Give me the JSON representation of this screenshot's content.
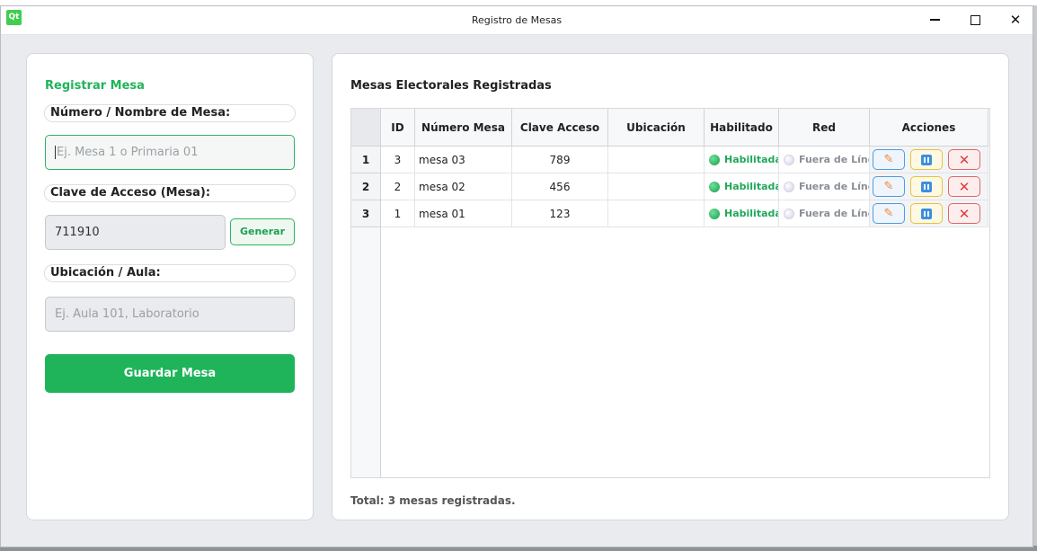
{
  "window": {
    "logo": "Qt",
    "title": "Registro de Mesas"
  },
  "form": {
    "heading": "Registrar Mesa",
    "name_label": "Número / Nombre de Mesa:",
    "name_placeholder": "Ej. Mesa 1 o Primaria 01",
    "key_label": "Clave de Acceso (Mesa):",
    "key_value": "711910",
    "generate_label": "Generar",
    "location_label": "Ubicación / Aula:",
    "location_placeholder": "Ej. Aula 101, Laboratorio",
    "save_label": "Guardar Mesa"
  },
  "table": {
    "title": "Mesas Electorales Registradas",
    "columns": [
      "ID",
      "Número Mesa",
      "Clave Acceso",
      "Ubicación",
      "Habilitado",
      "Red",
      "Acciones"
    ],
    "rows": [
      {
        "num": "1",
        "id": "3",
        "name": "mesa 03",
        "key": "789",
        "location": "",
        "enabled": "Habilitada",
        "network": "Fuera de Línea"
      },
      {
        "num": "2",
        "id": "2",
        "name": "mesa 02",
        "key": "456",
        "location": "",
        "enabled": "Habilitada",
        "network": "Fuera de Línea"
      },
      {
        "num": "3",
        "id": "1",
        "name": "mesa 01",
        "key": "123",
        "location": "",
        "enabled": "Habilitada",
        "network": "Fuera de Línea"
      }
    ],
    "total": "Total: 3 mesas registradas."
  },
  "colors": {
    "accent_green": "#1fb45a",
    "edit_border": "#4f9bde",
    "pause_border": "#e3c43b",
    "delete_border": "#e06767"
  },
  "icons": {
    "edit": "pencil-icon",
    "pause": "pause-icon",
    "delete": "close-icon",
    "status_enabled": "green-dot-icon",
    "status_network": "gray-dot-icon"
  }
}
